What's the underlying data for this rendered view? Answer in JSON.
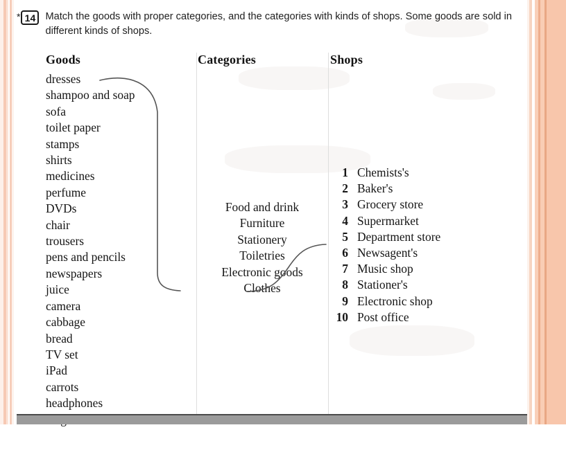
{
  "task": {
    "asterisk": "*",
    "number": "14",
    "instruction": "Match the goods with proper categories, and the categories with kinds of shops. Some goods are sold in different kinds of shops."
  },
  "columns": {
    "goods": {
      "heading": "Goods",
      "items": [
        "dresses",
        "shampoo and soap",
        "sofa",
        "toilet paper",
        "stamps",
        "shirts",
        "medicines",
        "perfume",
        "DVDs",
        "chair",
        "trousers",
        "pens and pencils",
        "newspapers",
        "juice",
        "camera",
        "cabbage",
        "bread",
        "TV set",
        "iPad",
        "carrots",
        "headphones",
        "magazines"
      ]
    },
    "categories": {
      "heading": "Categories",
      "items": [
        "Food and drink",
        "Furniture",
        "Stationery",
        "Toiletries",
        "Electronic goods",
        "Clothes"
      ]
    },
    "shops": {
      "heading": "Shops",
      "items": [
        {
          "number": "1",
          "name": "Chemists's"
        },
        {
          "number": "2",
          "name": "Baker's"
        },
        {
          "number": "3",
          "name": "Grocery store"
        },
        {
          "number": "4",
          "name": "Supermarket"
        },
        {
          "number": "5",
          "name": "Department store"
        },
        {
          "number": "6",
          "name": "Newsagent's"
        },
        {
          "number": "7",
          "name": "Music shop"
        },
        {
          "number": "8",
          "name": "Stationer's"
        },
        {
          "number": "9",
          "name": "Electronic shop"
        },
        {
          "number": "10",
          "name": "Post office"
        }
      ]
    }
  },
  "connections": [
    {
      "from": "dresses",
      "to": "Clothes"
    },
    {
      "from": "Clothes",
      "to": "5"
    }
  ],
  "colors": {
    "page_background": "#ffffff",
    "text": "#151515",
    "frame_accent": "#f8c6ab",
    "bottom_bar": "#9b9b9b",
    "connector_line": "#555555"
  }
}
